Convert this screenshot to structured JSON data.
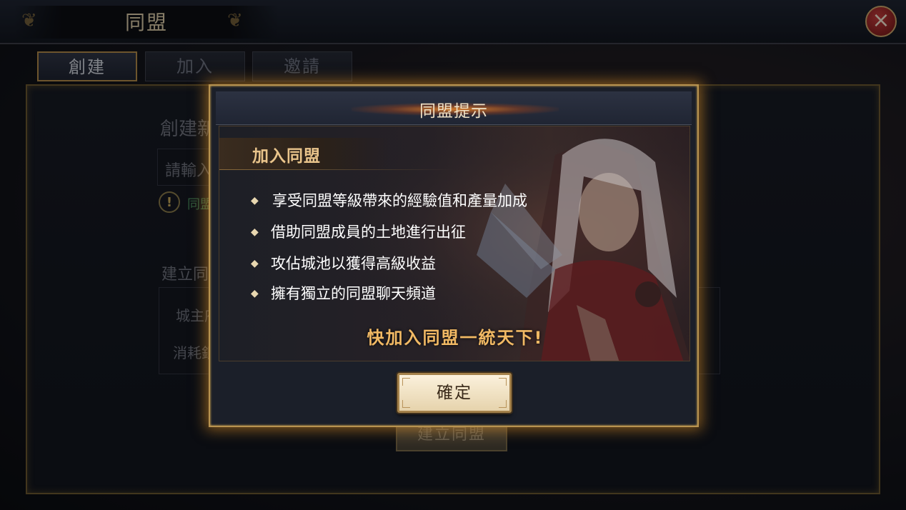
{
  "window": {
    "title": "同盟"
  },
  "tabs": [
    {
      "label": "創建",
      "active": true
    },
    {
      "label": "加入",
      "active": false
    },
    {
      "label": "邀請",
      "active": false
    }
  ],
  "background_panel": {
    "heading": "創建新",
    "name_input_placeholder": "請輸入",
    "notice": "同盟",
    "requirements_heading": "建立同",
    "row_city_lord": "城主府",
    "row_cost": "消耗銀",
    "create_button": "建立同盟"
  },
  "dialog": {
    "title": "同盟提示",
    "section_title": "加入同盟",
    "benefits": [
      "享受同盟等級帶來的經驗值和產量加成",
      "借助同盟成員的土地進行出征",
      "攻佔城池以獲得高級收益",
      "擁有獨立的同盟聊天頻道"
    ],
    "slogan": "快加入同盟一統天下!",
    "confirm_button": "確定"
  },
  "icons": {
    "close": "close-icon",
    "warning": "exclamation-icon",
    "bullet": "diamond-bullet-icon",
    "dragon": "dragon-ornament-icon"
  },
  "colors": {
    "accent_gold": "#b89350",
    "slogan_orange": "#f1b964",
    "close_red": "#c23b3b"
  }
}
